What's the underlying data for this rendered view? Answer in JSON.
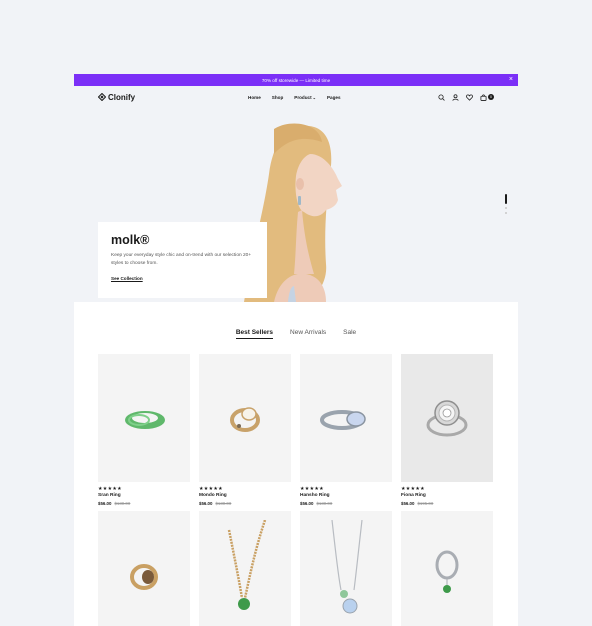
{
  "announcement": {
    "text": "70% off storewide — Limited time",
    "close": "×"
  },
  "brand": {
    "name": "Clonify",
    "accent": "#7b2ff7"
  },
  "nav": {
    "items": [
      {
        "label": "Home"
      },
      {
        "label": "Shop"
      },
      {
        "label": "Product"
      },
      {
        "label": "Pages"
      }
    ],
    "product_chevron": "⌄",
    "cart_count": "0",
    "icons": [
      "search-icon",
      "user-icon",
      "heart-icon",
      "bag-icon"
    ]
  },
  "hero": {
    "title": "molk®",
    "description": "Keep your everyday style chic and on-trend with our selection 20+ styles to choose from.",
    "cta": "See Collection",
    "slides": 3,
    "active_slide": 1
  },
  "tabs": [
    {
      "label": "Best Sellers",
      "active": true
    },
    {
      "label": "New Arrivals",
      "active": false
    },
    {
      "label": "Sale",
      "active": false
    }
  ],
  "products": [
    {
      "name": "Sran Ring",
      "price": "$56.00",
      "old_price": "$130.00",
      "rating": "★★★★★",
      "image": "green-glass-ring"
    },
    {
      "name": "Mondo Ring",
      "price": "$56.00",
      "old_price": "$130.00",
      "rating": "★★★★★",
      "image": "pearl-gold-ring"
    },
    {
      "name": "Hansho Ring",
      "price": "$56.00",
      "old_price": "$130.00",
      "rating": "★★★★★",
      "image": "opal-silver-ring"
    },
    {
      "name": "Fiona Ring",
      "price": "$56.00",
      "old_price": "$195.00",
      "rating": "★★★★★",
      "image": "diamond-halo-ring"
    }
  ],
  "products_row2": [
    {
      "image": "brown-stone-gold-ring"
    },
    {
      "image": "green-pendant-gold-chain"
    },
    {
      "image": "blue-pendant-silver-chain"
    },
    {
      "image": "green-drop-silver-ring"
    }
  ]
}
